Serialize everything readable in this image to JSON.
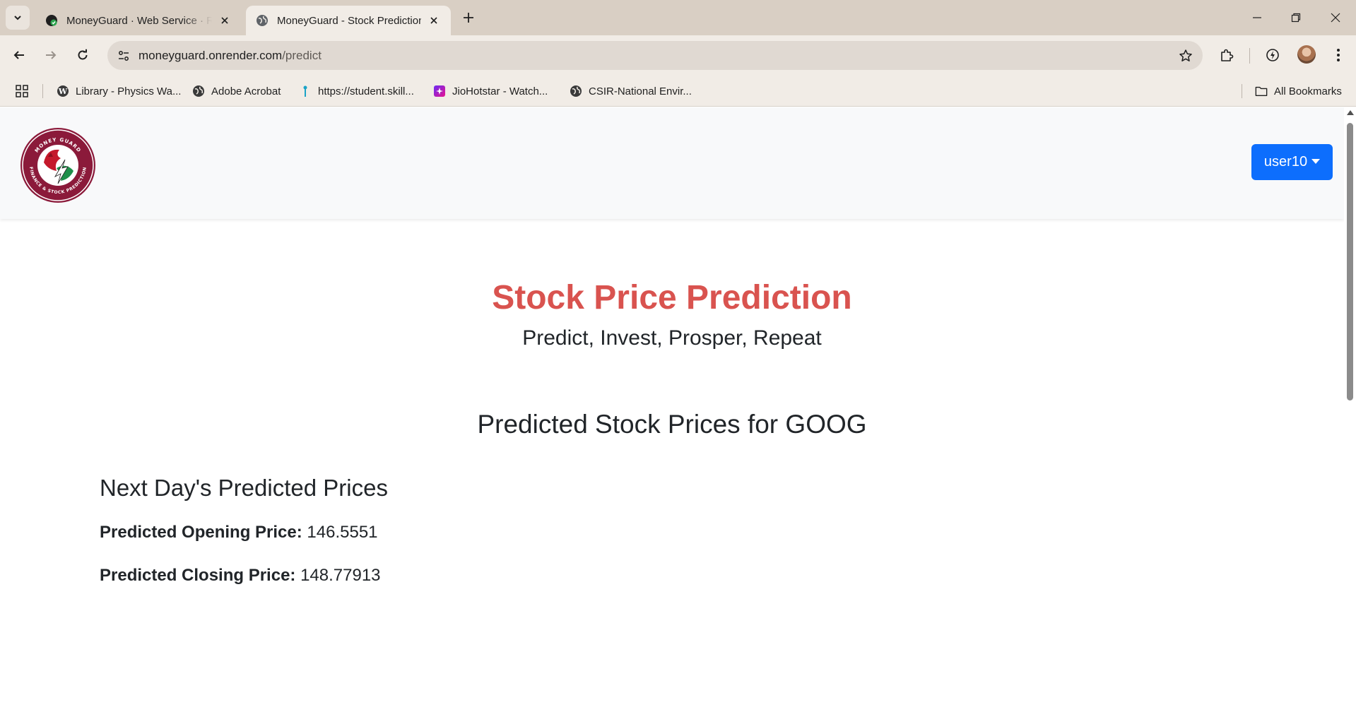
{
  "browser": {
    "tabs": [
      {
        "title": "MoneyGuard · Web Service · Render",
        "icon": "render-favicon",
        "active": false
      },
      {
        "title": "MoneyGuard - Stock Prediction",
        "icon": "globe-icon",
        "active": true
      }
    ],
    "url_host": "moneyguard.onrender.com",
    "url_path": "/predict",
    "bookmarks": [
      {
        "label": "Library - Physics Wa...",
        "icon": "wordpress-icon"
      },
      {
        "label": "Adobe Acrobat",
        "icon": "globe-icon"
      },
      {
        "label": "https://student.skill...",
        "icon": "pin-icon"
      },
      {
        "label": "JioHotstar - Watch...",
        "icon": "hotstar-icon"
      },
      {
        "label": "CSIR-National Envir...",
        "icon": "globe-icon"
      }
    ],
    "all_bookmarks_label": "All Bookmarks"
  },
  "navbar": {
    "logo_text": "MONEY GUARD · FINANCE & STOCK PREDICTION",
    "user_label": "user10",
    "colors": {
      "button": "#0d6efd",
      "logo_ring": "#8b1a3a"
    }
  },
  "main": {
    "title": "Stock Price Prediction",
    "subtitle": "Predict, Invest, Prosper, Repeat",
    "prediction_heading": "Predicted Stock Prices for GOOG",
    "next_day_heading": "Next Day's Predicted Prices",
    "opening_label": "Predicted Opening Price:",
    "opening_value": "146.5551",
    "closing_label": "Predicted Closing Price:",
    "closing_value": "148.77913",
    "title_color": "#d9534f"
  }
}
